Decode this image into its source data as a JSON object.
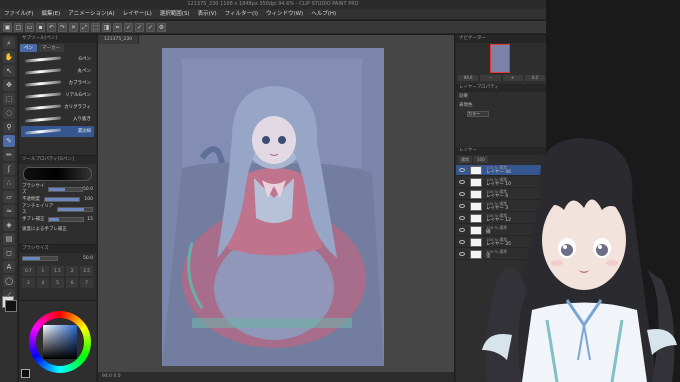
{
  "window": {
    "title": "121375_230 1168 x 1848px 350dpi 94.6% - CLIP STUDIO PAINT PRO"
  },
  "menubar": {
    "items": [
      "ファイル(F)",
      "編集(E)",
      "アニメーション(A)",
      "レイヤー(L)",
      "選択範囲(S)",
      "表示(V)",
      "フィルター(I)",
      "ウィンドウ(W)",
      "ヘルプ(H)"
    ]
  },
  "subtool": {
    "panel_title": "サブツール[ペン]",
    "tabs": [
      "ペン",
      "マーカー"
    ],
    "brushes": [
      {
        "label": "Gペン",
        "selected": false
      },
      {
        "label": "丸ペン",
        "selected": false
      },
      {
        "label": "カブラペン",
        "selected": false
      },
      {
        "label": "リアルGペン",
        "selected": false
      },
      {
        "label": "カリグラフィ",
        "selected": false
      },
      {
        "label": "入り抜き",
        "selected": false
      },
      {
        "label": "濃淡線",
        "selected": true
      }
    ]
  },
  "toolprop": {
    "panel_title": "ツールプロパティ[Gペン]",
    "rows": [
      {
        "label": "ブラシサイズ",
        "value": "50.0",
        "fill": 0.5
      },
      {
        "label": "不透明度",
        "value": "100",
        "fill": 1.0
      },
      {
        "label": "アンチエイリアス",
        "value": "",
        "fill": 0.75
      },
      {
        "label": "手ブレ補正",
        "value": "15",
        "fill": 0.3
      }
    ],
    "checkbox_label": "速度による手ブレ補正"
  },
  "brushsize": {
    "panel_title": "ブラシサイズ",
    "value": "50.0",
    "sizes": [
      "0.7",
      "1",
      "1.5",
      "2",
      "2.5",
      "3",
      "4",
      "5",
      "6",
      "7"
    ]
  },
  "canvas": {
    "doc_tab": "121375_230",
    "zoom": "94.6",
    "status": "94.6   0.0"
  },
  "navigator": {
    "title": "ナビゲーター",
    "zoom": "94.6",
    "angle": "0.0"
  },
  "layerprop": {
    "title": "レイヤープロパティ",
    "effect_label": "効果",
    "opacity_label": "表現色",
    "color_value": "カラー"
  },
  "layers": {
    "title": "レイヤー",
    "blend_mode": "通常",
    "opacity": "100",
    "items": [
      {
        "blend": "100 % 通常",
        "name": "レイヤー 46",
        "selected": true
      },
      {
        "blend": "100 % 通常",
        "name": "レイヤー 10",
        "selected": false
      },
      {
        "blend": "100 % 通常",
        "name": "レイヤー 4",
        "selected": false
      },
      {
        "blend": "100 % 通常",
        "name": "レイヤー 3",
        "selected": false
      },
      {
        "blend": "100 % 通常",
        "name": "レイヤー 12",
        "selected": false
      },
      {
        "blend": "100 % 通常",
        "name": "線",
        "selected": false
      },
      {
        "blend": "100 % 通常",
        "name": "レイヤー 35",
        "selected": false
      },
      {
        "blend": "100 % 通常",
        "name": "塗",
        "selected": false
      }
    ]
  },
  "colors": {
    "main": "#0e0e0e",
    "sub": "#ffffff",
    "selection_accent": "#35568f",
    "nav_frame": "#e53935"
  }
}
